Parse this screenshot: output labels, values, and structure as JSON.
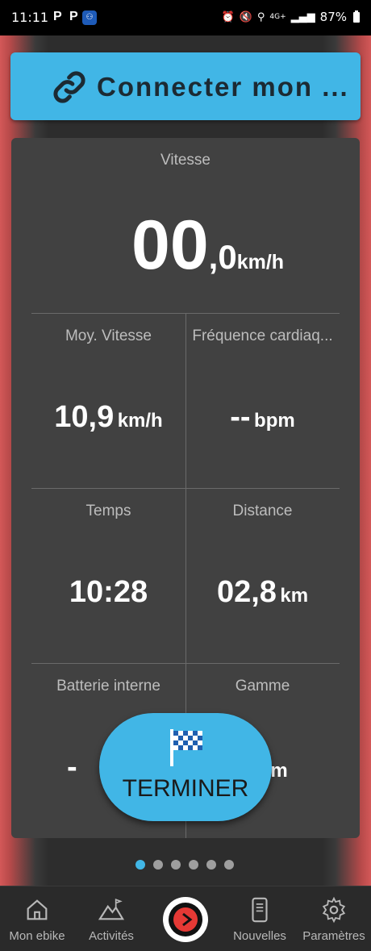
{
  "status": {
    "time": "11:11",
    "p1": "P",
    "p2": "P",
    "network": "4G+",
    "battery": "87%"
  },
  "connect": {
    "label": "Connecter mon ..."
  },
  "speed": {
    "title": "Vitesse",
    "int": "00",
    "dec": ",0",
    "unit": "km/h"
  },
  "cells": {
    "avg_speed": {
      "title": "Moy. Vitesse",
      "value": "10,9",
      "unit": "km/h"
    },
    "heart_rate": {
      "title": "Fréquence cardiaq...",
      "value": "--",
      "unit": "bpm"
    },
    "time": {
      "title": "Temps",
      "value": "10:28",
      "unit": ""
    },
    "distance": {
      "title": "Distance",
      "value": "02,8",
      "unit": "km"
    },
    "battery": {
      "title": "Batterie interne",
      "value": "-",
      "unit": ""
    },
    "range": {
      "title": "Gamme",
      "value": "",
      "unit": "km"
    }
  },
  "terminer": {
    "label": "TERMINER"
  },
  "pager": {
    "count": 6,
    "active": 0
  },
  "nav": {
    "items": [
      {
        "label": "Mon ebike",
        "icon": "home-icon"
      },
      {
        "label": "Activités",
        "icon": "mountain-icon"
      },
      {
        "label": "",
        "icon": "record-icon"
      },
      {
        "label": "Nouvelles",
        "icon": "phone-news-icon"
      },
      {
        "label": "Paramètres",
        "icon": "gear-icon"
      }
    ]
  },
  "colors": {
    "accent": "#41b6e6",
    "record": "#e53935",
    "card": "#414141"
  }
}
